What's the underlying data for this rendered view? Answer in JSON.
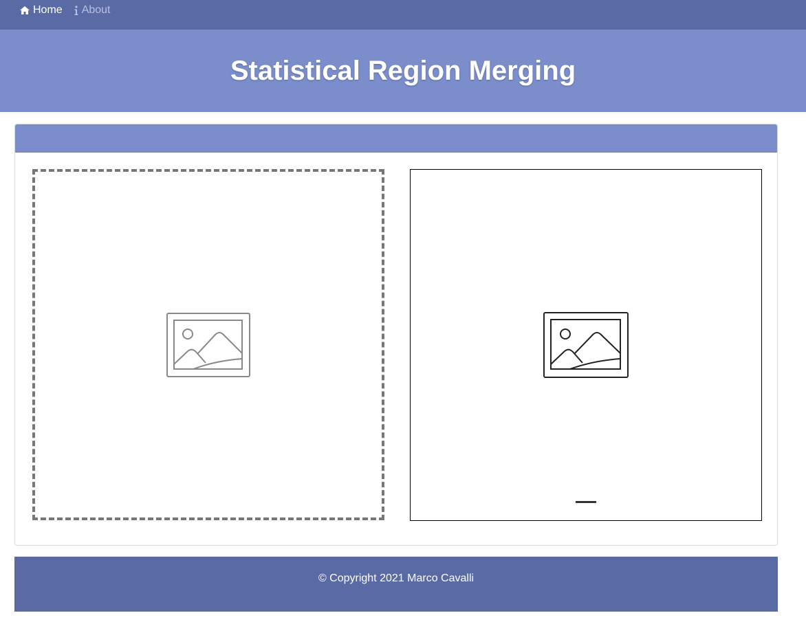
{
  "nav": {
    "home_label": "Home",
    "about_label": "About"
  },
  "hero": {
    "title": "Statistical Region Merging"
  },
  "panels": {
    "input_icon": "image-placeholder-icon",
    "output_icon": "image-placeholder-icon"
  },
  "footer": {
    "copyright": "© Copyright 2021 Marco Cavalli"
  },
  "colors": {
    "navbar": "#5a6aa5",
    "hero": "#7b8dca",
    "card_header": "#7b8dca",
    "footer": "#5a6aa5"
  }
}
